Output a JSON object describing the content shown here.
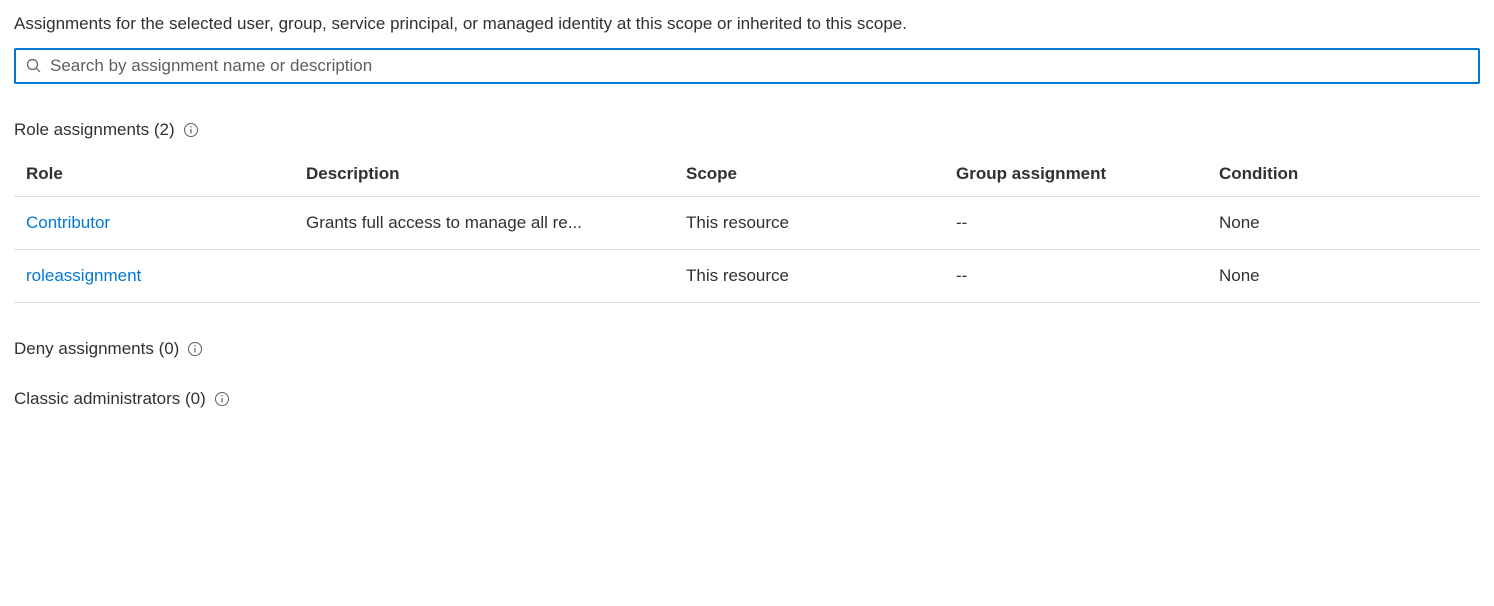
{
  "header": {
    "description": "Assignments for the selected user, group, service principal, or managed identity at this scope or inherited to this scope."
  },
  "search": {
    "placeholder": "Search by assignment name or description",
    "value": ""
  },
  "roleAssignments": {
    "title": "Role assignments (2)",
    "columns": {
      "role": "Role",
      "description": "Description",
      "scope": "Scope",
      "groupAssignment": "Group assignment",
      "condition": "Condition"
    },
    "rows": [
      {
        "role": "Contributor",
        "description": "Grants full access to manage all re...",
        "scope": "This resource",
        "groupAssignment": "--",
        "condition": "None"
      },
      {
        "role": "roleassignment",
        "description": "",
        "scope": "This resource",
        "groupAssignment": "--",
        "condition": "None"
      }
    ]
  },
  "denyAssignments": {
    "title": "Deny assignments (0)"
  },
  "classicAdministrators": {
    "title": "Classic administrators (0)"
  }
}
